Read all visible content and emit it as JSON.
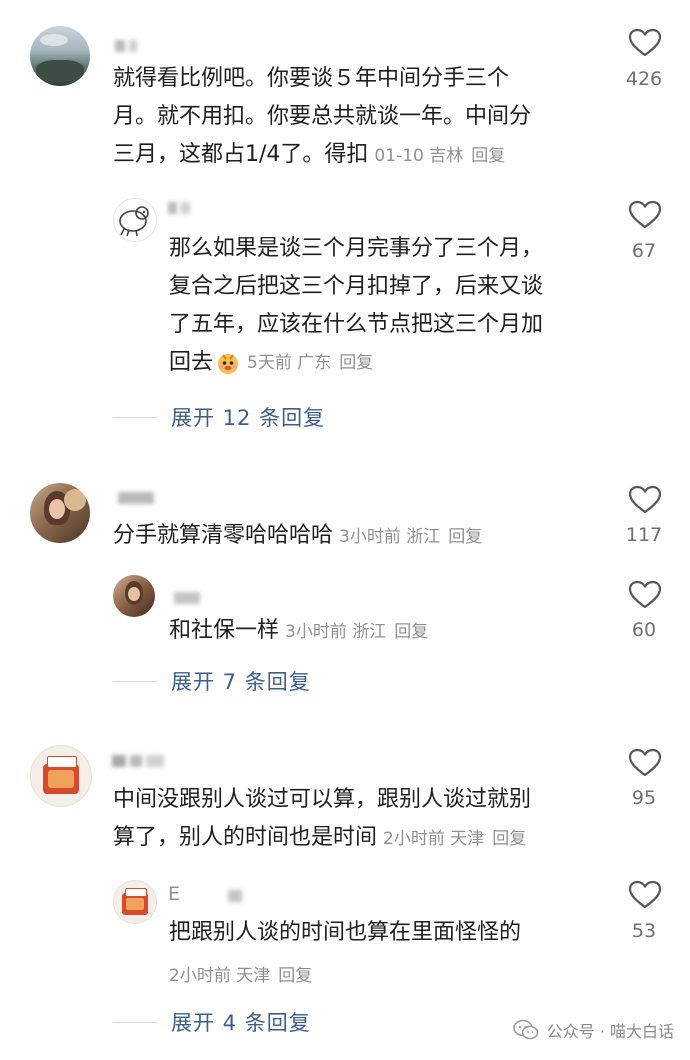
{
  "comments": [
    {
      "text_lines": [
        "就得看比例吧。你要谈５年中间分手三个",
        "月。就不用扣。你要总共就谈一年。中间分",
        "三月，这都占1/4了。得扣"
      ],
      "date": "01-10",
      "location": "吉林",
      "reply_label": "回复",
      "likes": "426"
    },
    {
      "text_lines": [
        "那么如果是谈三个月完事分了三个月，",
        "复合之后把这三个月扣掉了，后来又谈",
        "了五年，应该在什么节点把这三个月加",
        "回去"
      ],
      "date": "5天前",
      "location": "广东",
      "reply_label": "回复",
      "likes": "67",
      "expand_label": "展开 12 条回复"
    },
    {
      "text_lines": [
        "分手就算清零哈哈哈哈"
      ],
      "date": "3小时前",
      "location": "浙江",
      "reply_label": "回复",
      "likes": "117"
    },
    {
      "text_lines": [
        "和社保一样"
      ],
      "date": "3小时前",
      "location": "浙江",
      "reply_label": "回复",
      "likes": "60",
      "expand_label": "展开 7 条回复"
    },
    {
      "text_lines": [
        "中间没跟别人谈过可以算，跟别人谈过就别",
        "算了，别人的时间也是时间"
      ],
      "date": "2小时前",
      "location": "天津",
      "reply_label": "回复",
      "likes": "95"
    },
    {
      "name_initial": "E",
      "text_lines": [
        "把跟别人谈的时间也算在里面怪怪的"
      ],
      "date": "2小时前",
      "location": "天津",
      "reply_label": "回复",
      "likes": "53",
      "expand_label": "展开 4 条回复"
    }
  ],
  "watermark": {
    "text": "公众号 · 喵大白话",
    "icon": "wechat-icon"
  },
  "colors": {
    "expand_link": "#3b5d8f",
    "meta": "#8f8f8f",
    "like_count": "#6f6f6f"
  }
}
